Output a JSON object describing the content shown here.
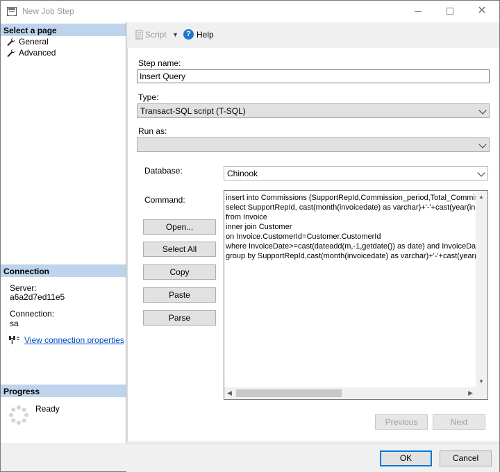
{
  "window": {
    "title": "New Job Step"
  },
  "left_pane": {
    "select_page_header": "Select a page",
    "pages": [
      {
        "label": "General"
      },
      {
        "label": "Advanced"
      }
    ],
    "connection_header": "Connection",
    "server_label": "Server:",
    "server_value": "a6a2d7ed11e5",
    "connection_label": "Connection:",
    "connection_value": "sa",
    "view_connection_link": "View connection properties",
    "progress_header": "Progress",
    "progress_status": "Ready"
  },
  "toolbar": {
    "script_label": "Script",
    "help_label": "Help"
  },
  "form": {
    "step_name_label": "Step name:",
    "step_name_value": "Insert Query",
    "type_label": "Type:",
    "type_value": "Transact-SQL script (T-SQL)",
    "run_as_label": "Run as:",
    "run_as_value": "",
    "database_label": "Database:",
    "database_value": "Chinook",
    "command_label": "Command:",
    "buttons": {
      "open": "Open...",
      "select_all": "Select All",
      "copy": "Copy",
      "paste": "Paste",
      "parse": "Parse"
    },
    "command_lines": [
      "insert into Commissions (SupportRepId,Commission_period,Total_Commiss",
      "select SupportRepId, cast(month(invoicedate) as varchar)+'-'+cast(year(in",
      "from Invoice",
      "inner join Customer",
      "on Invoice.CustomerId=Customer.CustomerId",
      "where InvoiceDate>=cast(dateadd(m,-1,getdate()) as date) and InvoiceDa",
      "group by SupportRepId,cast(month(invoicedate) as varchar)+'-'+cast(year("
    ],
    "previous_label": "Previous",
    "next_label": "Next"
  },
  "footer": {
    "ok_label": "OK",
    "cancel_label": "Cancel"
  }
}
